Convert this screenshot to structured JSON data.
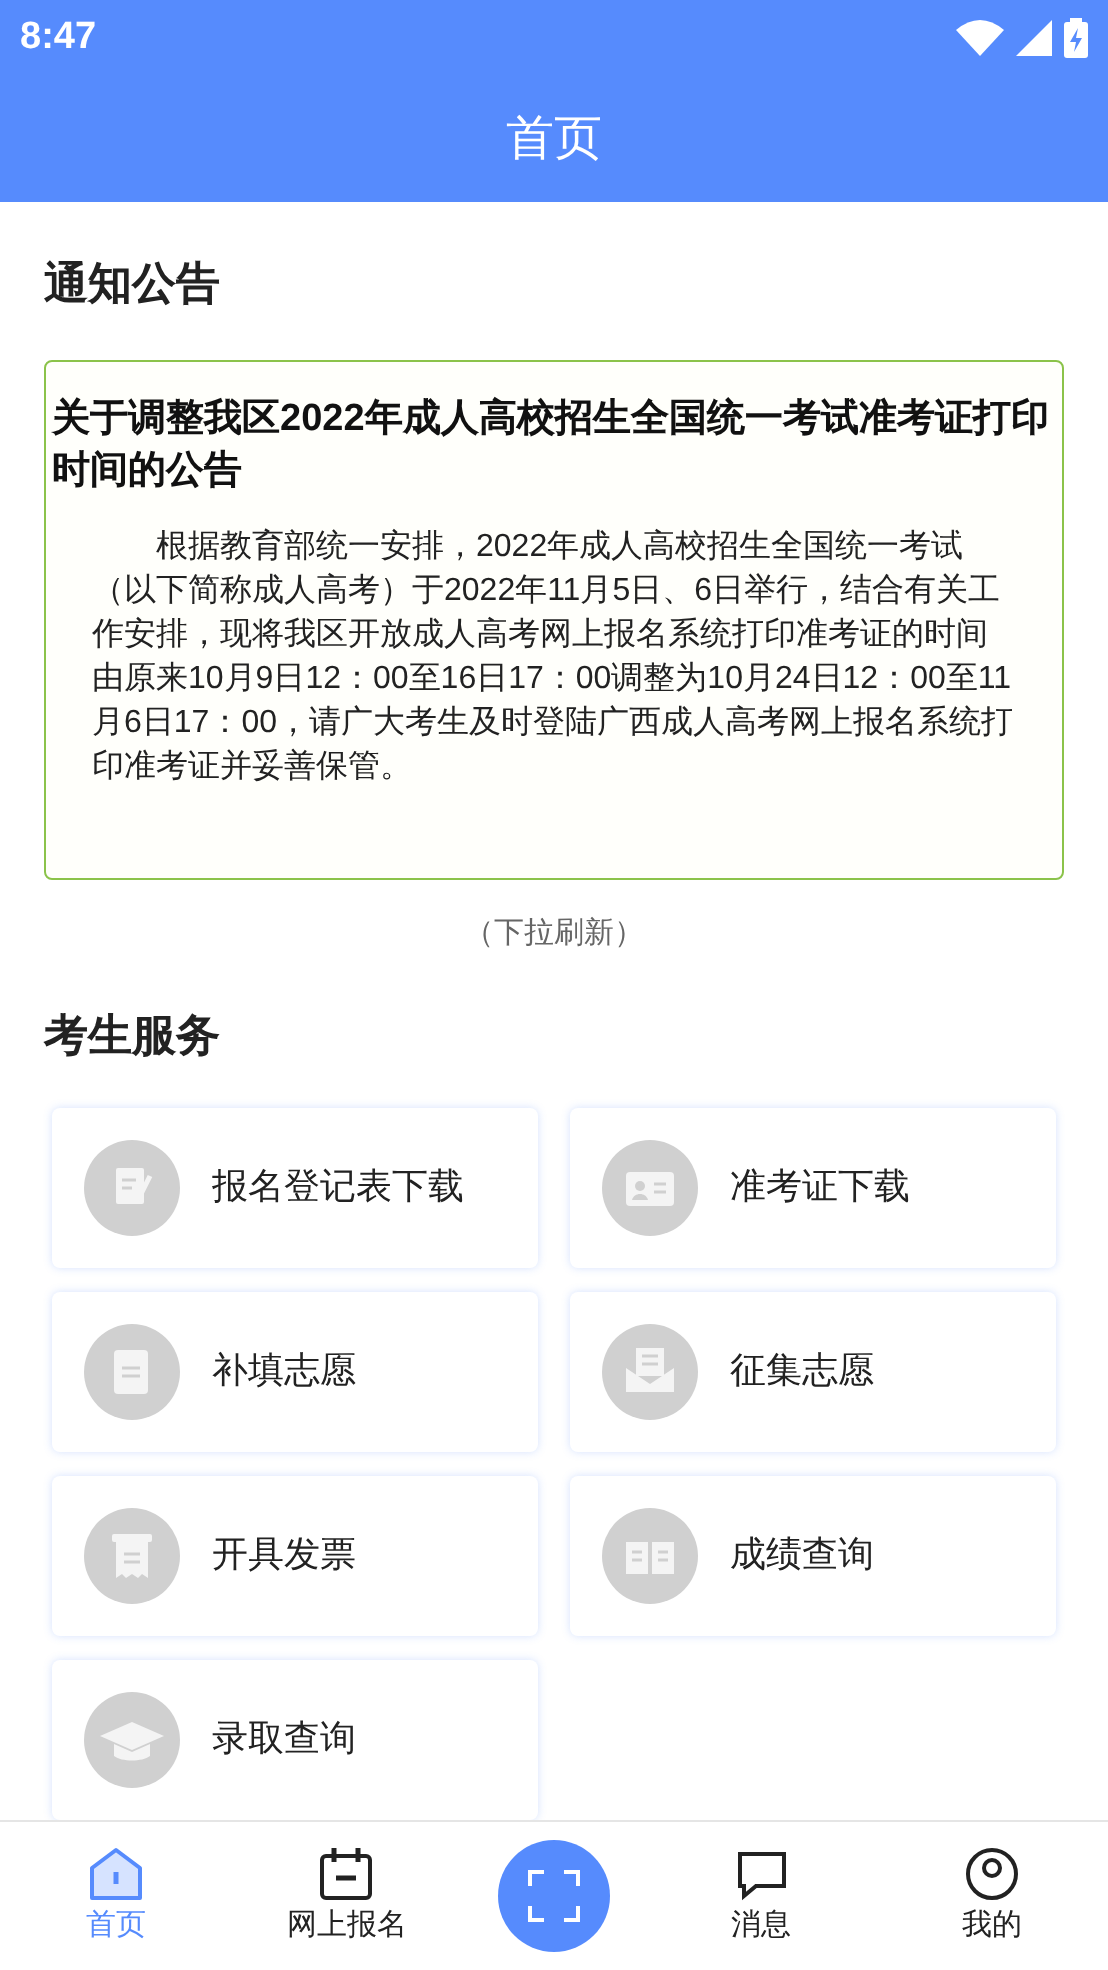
{
  "status_bar": {
    "time": "8:47"
  },
  "header": {
    "title": "首页"
  },
  "notice_section": {
    "title": "通知公告",
    "notice_title": "关于调整我区2022年成人高校招生全国统一考试准考证打印时间的公告",
    "notice_body": "根据教育部统一安排，2022年成人高校招生全国统一考试（以下简称成人高考）于2022年11月5日、6日举行，结合有关工作安排，现将我区开放成人高考网上报名系统打印准考证的时间由原来10月9日12：00至16日17：00调整为10月24日12：00至11月6日17：00，请广大考生及时登陆广西成人高考网上报名系统打印准考证并妥善保管。",
    "hint": "（下拉刷新）"
  },
  "services": {
    "title": "考生服务",
    "items": [
      {
        "kind": "form",
        "label": "报名登记表下载"
      },
      {
        "kind": "card",
        "label": "准考证下载"
      },
      {
        "kind": "doc",
        "label": "补填志愿"
      },
      {
        "kind": "mail",
        "label": "征集志愿"
      },
      {
        "kind": "receipt",
        "label": "开具发票"
      },
      {
        "kind": "book",
        "label": "成绩查询"
      },
      {
        "kind": "cap",
        "label": "录取查询"
      }
    ]
  },
  "bottom_nav": [
    {
      "kind": "home",
      "label": "首页",
      "selected": true
    },
    {
      "kind": "calendar",
      "label": "网上报名",
      "selected": false
    },
    {
      "kind": "scan"
    },
    {
      "kind": "message",
      "label": "消息",
      "selected": false
    },
    {
      "kind": "user",
      "label": "我的",
      "selected": false
    }
  ]
}
